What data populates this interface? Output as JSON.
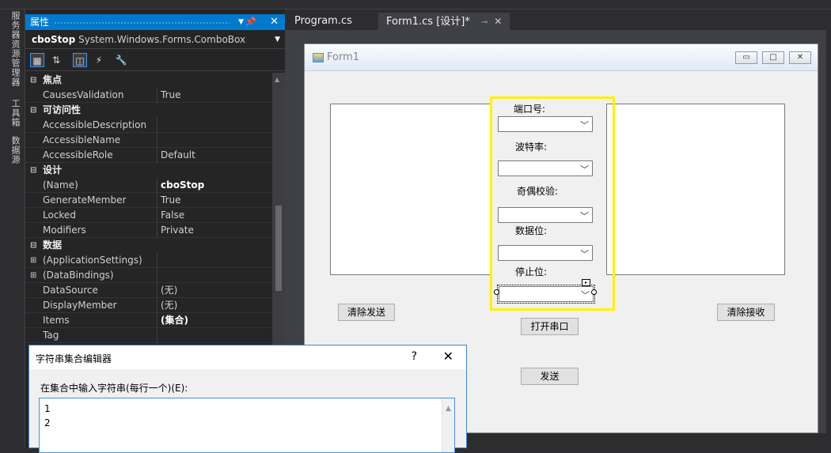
{
  "sidebar": {
    "tabs": [
      "服务器资源管理器",
      "工具箱",
      "数据源"
    ]
  },
  "properties": {
    "title": "属性",
    "object_name": "cboStop",
    "object_type": "System.Windows.Forms.ComboBox",
    "rows": [
      {
        "kind": "cat",
        "toggle": "⊟",
        "label": "焦点"
      },
      {
        "kind": "prop",
        "name": "CausesValidation",
        "value": "True"
      },
      {
        "kind": "cat",
        "toggle": "⊟",
        "label": "可访问性"
      },
      {
        "kind": "prop",
        "name": "AccessibleDescription",
        "value": ""
      },
      {
        "kind": "prop",
        "name": "AccessibleName",
        "value": ""
      },
      {
        "kind": "prop",
        "name": "AccessibleRole",
        "value": "Default"
      },
      {
        "kind": "cat",
        "toggle": "⊟",
        "label": "设计"
      },
      {
        "kind": "prop",
        "name": "(Name)",
        "value": "cboStop",
        "bold": true
      },
      {
        "kind": "prop",
        "name": "GenerateMember",
        "value": "True"
      },
      {
        "kind": "prop",
        "name": "Locked",
        "value": "False"
      },
      {
        "kind": "prop",
        "name": "Modifiers",
        "value": "Private"
      },
      {
        "kind": "cat",
        "toggle": "⊟",
        "label": "数据"
      },
      {
        "kind": "prop",
        "toggle": "⊞",
        "name": "(ApplicationSettings)",
        "value": ""
      },
      {
        "kind": "prop",
        "toggle": "⊞",
        "name": "(DataBindings)",
        "value": ""
      },
      {
        "kind": "prop",
        "name": "DataSource",
        "value": "(无)"
      },
      {
        "kind": "prop",
        "name": "DisplayMember",
        "value": "(无)"
      },
      {
        "kind": "prop",
        "name": "Items",
        "value": "(集合)",
        "bold": true
      },
      {
        "kind": "prop",
        "name": "Tag",
        "value": ""
      }
    ]
  },
  "tabs": [
    {
      "label": "Program.cs",
      "active": false
    },
    {
      "label": "Form1.cs [设计]*",
      "active": true,
      "pin": "⊸",
      "close": "✕"
    }
  ],
  "form": {
    "title": "Form1",
    "labels": {
      "port": "端口号:",
      "baud": "波特率:",
      "parity": "奇偶校验:",
      "databits": "数据位:",
      "stopbits": "停止位:"
    },
    "buttons": {
      "clear_send": "清除发送",
      "clear_recv": "清除接收",
      "open_port": "打开串口",
      "send": "发送"
    }
  },
  "dialog": {
    "title": "字符串集合编辑器",
    "help": "?",
    "instruction": "在集合中输入字符串(每行一个)(E):",
    "lines": [
      "1",
      "2"
    ]
  },
  "colors": {
    "accent": "#007acc",
    "highlight": "#fff200"
  }
}
